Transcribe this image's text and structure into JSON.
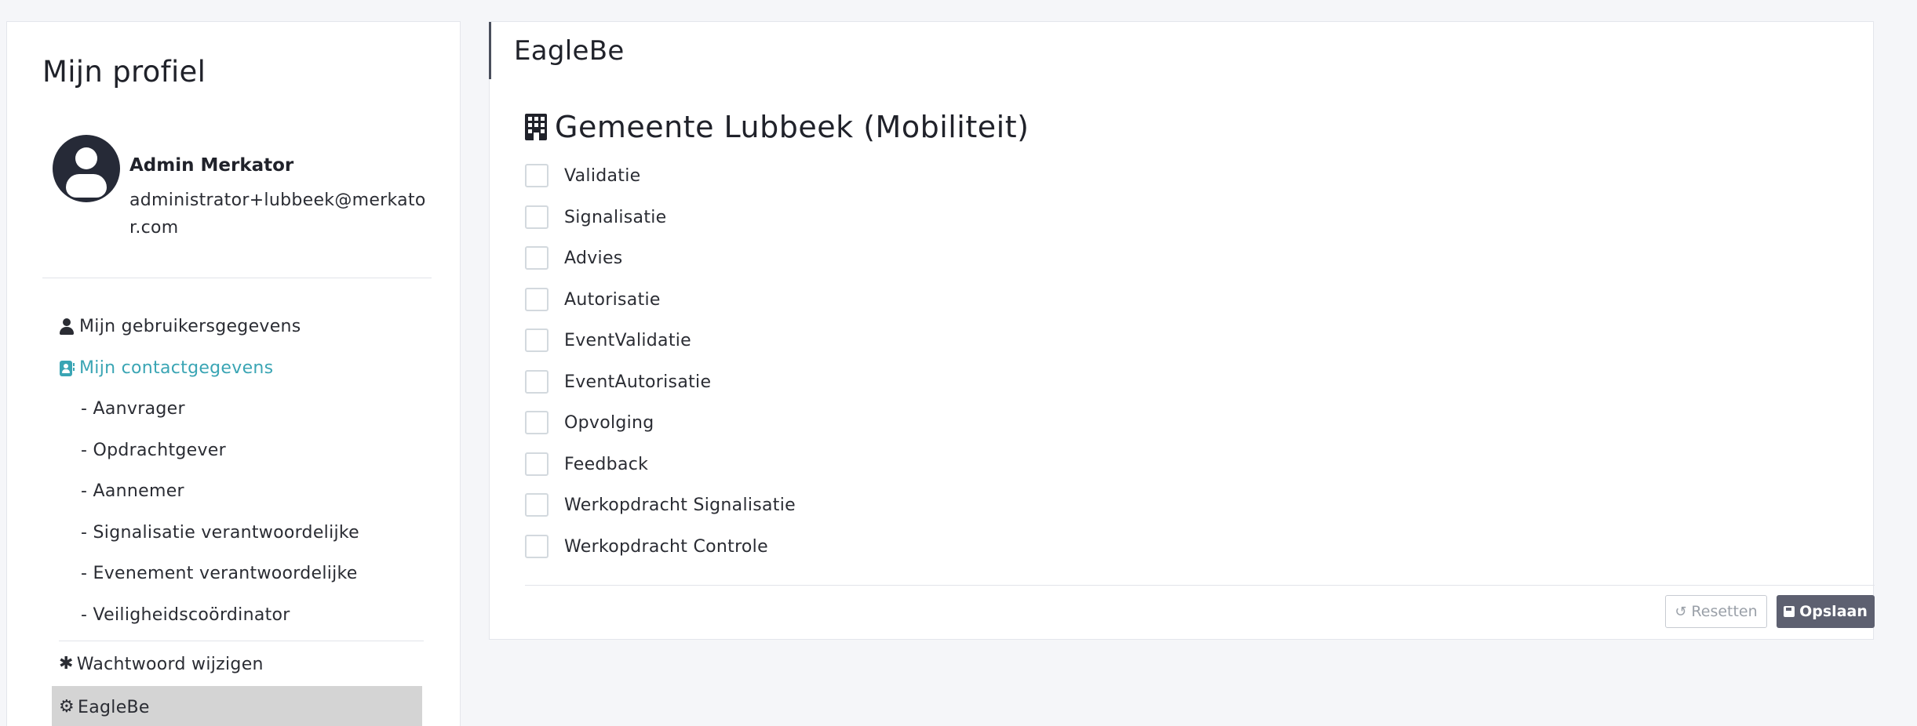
{
  "sidebar": {
    "title": "Mijn profiel",
    "user": {
      "name": "Admin Merkator",
      "email": "administrator+lubbeek@merkator.com"
    },
    "nav": [
      {
        "label": "Mijn gebruikersgegevens",
        "icon": "user-icon"
      },
      {
        "label": "Mijn contactgegevens",
        "icon": "contact-card-icon",
        "active": true
      }
    ],
    "contact_subitems": [
      "- Aanvrager",
      "- Opdrachtgever",
      "- Aannemer",
      "- Signalisatie verantwoordelijke",
      "- Evenement verantwoordelijke",
      "- Veiligheidscoördinator"
    ],
    "password_label": "Wachtwoord wijzigen",
    "eaglebe_label": "EagleBe"
  },
  "main": {
    "title": "EagleBe",
    "organization": "Gemeente Lubbeek (Mobiliteit)",
    "roles": [
      {
        "label": "Validatie",
        "checked": false
      },
      {
        "label": "Signalisatie",
        "checked": false
      },
      {
        "label": "Advies",
        "checked": false
      },
      {
        "label": "Autorisatie",
        "checked": false
      },
      {
        "label": "EventValidatie",
        "checked": false
      },
      {
        "label": "EventAutorisatie",
        "checked": false
      },
      {
        "label": "Opvolging",
        "checked": false
      },
      {
        "label": "Feedback",
        "checked": false
      },
      {
        "label": "Werkopdracht Signalisatie",
        "checked": false
      },
      {
        "label": "Werkopdracht Controle",
        "checked": false
      }
    ],
    "reset_label": "Resetten",
    "save_label": "Opslaan"
  },
  "colors": {
    "accent": "#3aa5b4",
    "save_button": "#5d6070",
    "selected_nav": "#d4d4d4"
  }
}
